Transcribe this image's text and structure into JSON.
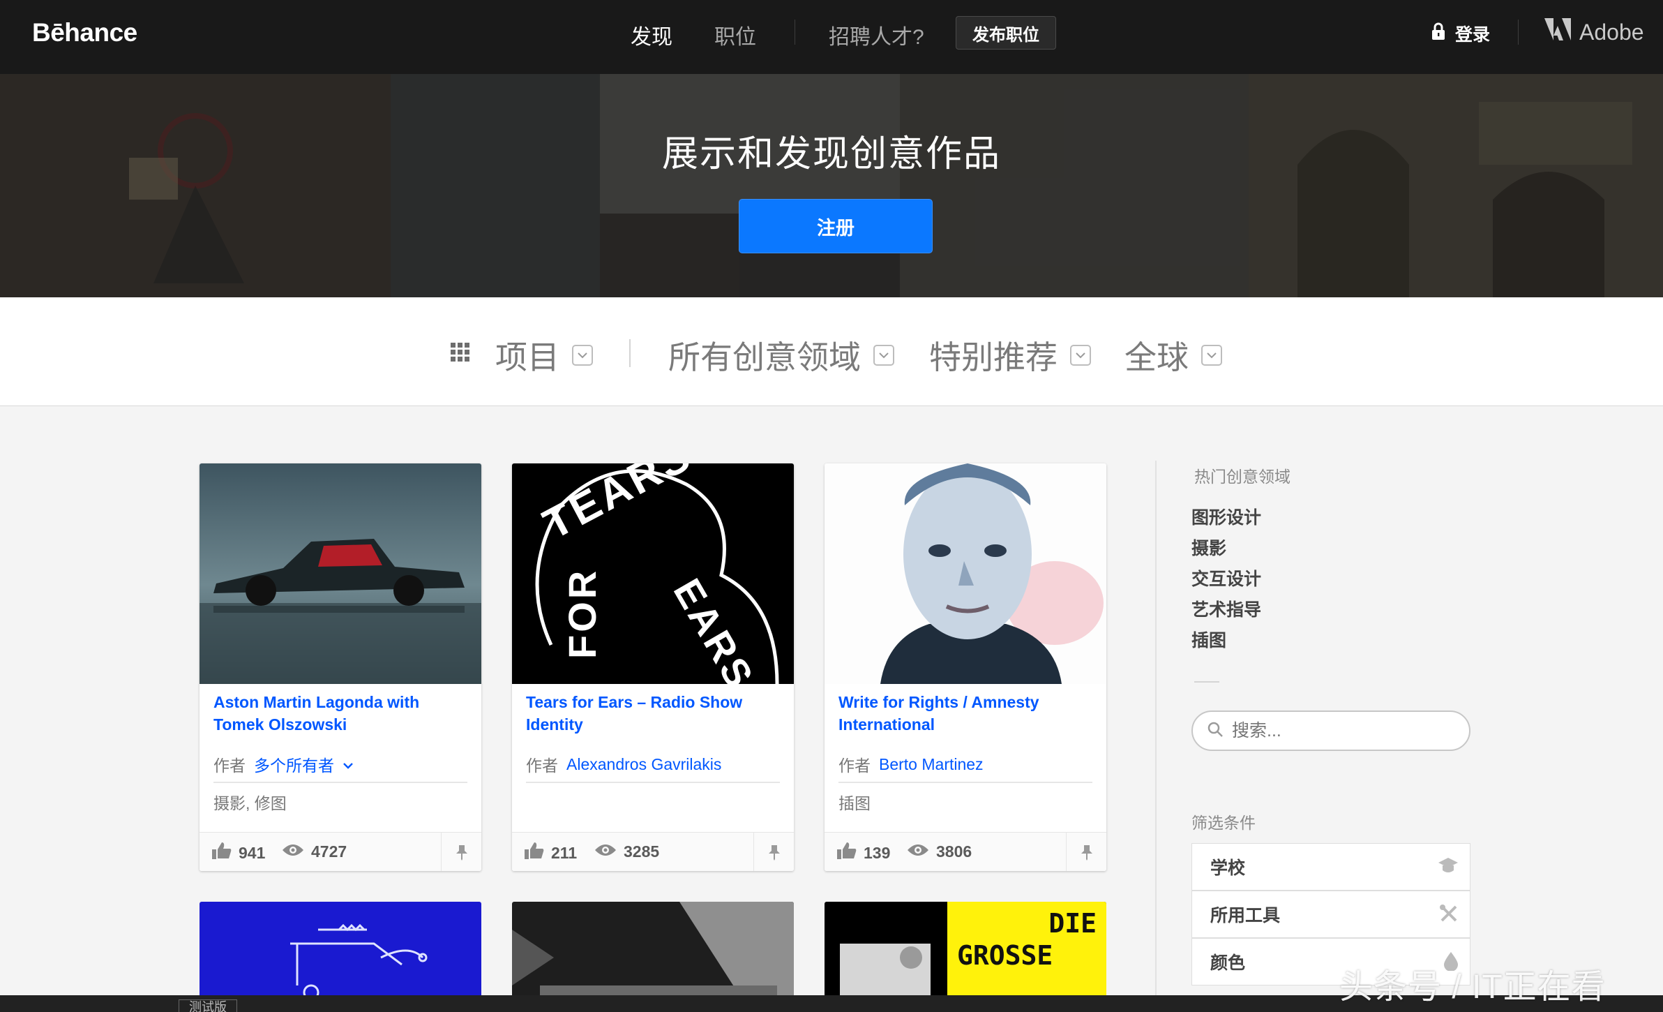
{
  "nav": {
    "logo": "Bēhance",
    "discover": "发现",
    "jobs": "职位",
    "hire": "招聘人才?",
    "post_job": "发布职位",
    "login": "登录",
    "adobe": "Adobe"
  },
  "hero": {
    "title": "展示和发现创意作品",
    "signup": "注册"
  },
  "filters": [
    {
      "label": "项目"
    },
    {
      "label": "所有创意领域"
    },
    {
      "label": "特别推荐"
    },
    {
      "label": "全球"
    }
  ],
  "projects": [
    {
      "title": "Aston Martin Lagonda with Tomek Olszowski",
      "by": "作者",
      "owner": "多个所有者",
      "fields": "摄影, 修图",
      "likes": "941",
      "views": "4727"
    },
    {
      "title": "Tears for Ears – Radio Show Identity",
      "by": "作者",
      "owner": "Alexandros Gavrilakis",
      "fields": "",
      "likes": "211",
      "views": "3285"
    },
    {
      "title": "Write for Rights / Amnesty International",
      "by": "作者",
      "owner": "Berto Martinez",
      "fields": "插图",
      "likes": "139",
      "views": "3806"
    }
  ],
  "thumb_text": {
    "tears_top": "TEARS",
    "tears_for": "FOR",
    "tears_ears": "EARS",
    "die": "DIE",
    "grosse": "GROSSE"
  },
  "sidebar": {
    "popular_heading": "热门创意领域",
    "popular": [
      "图形设计",
      "摄影",
      "交互设计",
      "艺术指导",
      "插图"
    ],
    "search_placeholder": "搜索...",
    "filter_heading": "筛选条件",
    "filter_boxes": [
      "学校",
      "所用工具",
      "颜色"
    ]
  },
  "bottom": {
    "tag": "测试版"
  },
  "watermark": "头条号 / IT正在看",
  "colors": {
    "accent_blue": "#0057ff",
    "signup_blue": "#0b78ff",
    "nav_bg": "#191919"
  }
}
